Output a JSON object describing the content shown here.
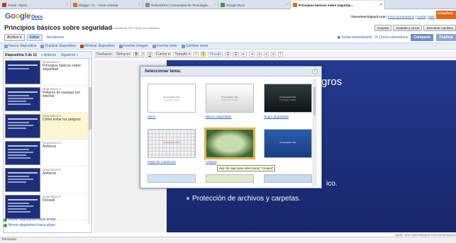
{
  "browser": {
    "tabs": [
      {
        "label": "Gmail - Spam",
        "fav_color": "#c0392b"
      },
      {
        "label": "Blogger: CL - Crear entrada",
        "fav_color": "#e26a1b"
      },
      {
        "label": "RedUSERS | Comunidad de Tecnología ...",
        "fav_color": "#8a8a8a"
      },
      {
        "label": "Google Docs",
        "fav_color": "#3a9a3a"
      },
      {
        "label": "Principios básicos sobre segurida...",
        "fav_color": "#e26a1b",
        "active": true
      }
    ]
  },
  "header": {
    "logo_letters": [
      "G",
      "o",
      "o",
      "g",
      "l",
      "e"
    ],
    "logo_docs": "Docs",
    "user_email": "franceloer@gmail.com",
    "link_inicio": "Inicio Documentos",
    "link_ayuda": "Ayuda",
    "link_salir": "Salir",
    "actualizar": "Actualizar"
  },
  "doc": {
    "title": "Principios básicos sobre seguridad",
    "saved_note": "Guardado el 4 de octubre de 2007 16:04 por Franceloer"
  },
  "top_buttons": {
    "guardar": "Guardar",
    "guardar_cerrar": "Guardar y cerrar",
    "descartar": "Descartar cambios"
  },
  "menu": {
    "archivo": "Archivo ▾",
    "editar": "Editar",
    "revisiones": "Revisiones",
    "iniciar": "Iniciar presentación",
    "correo": "Correo electrónico",
    "compartir": "Compartir",
    "publicar": "Publicar"
  },
  "actions": [
    "Nueva diapositiva",
    "Duplicar diapositiva",
    "Eliminar diapositiva",
    "Insertar imagen",
    "Insertar texto",
    "Cambiar tema"
  ],
  "slides_panel": {
    "counter": "Diapositiva 3 de 12",
    "prev": "« Anterior",
    "next": "Siguiente »",
    "move_up": "Mover diapositiva hacia arriba",
    "move_down": "Mover diapositiva hacia abajo",
    "items": [
      {
        "num": "Diapositiva 1",
        "title": "Principios básicos sobre seguridad"
      },
      {
        "num": "Diapositiva 2",
        "title": "Peligros de navegar por internet"
      },
      {
        "num": "Diapositiva 3",
        "title": "Cómo evitar los peligros",
        "selected": true
      },
      {
        "num": "Diapositiva 4",
        "title": "Antivirus"
      },
      {
        "num": "Diapositiva 5",
        "title": "Antivirus"
      },
      {
        "num": "Diapositiva 6",
        "title": "Firewall"
      }
    ]
  },
  "format_bar": [
    "Deshacer",
    "Rehacer",
    "B",
    "I",
    "U",
    "Fuente ▾",
    "Tamaño ▾",
    "T",
    "T",
    "Vínculo",
    "☰",
    "☰",
    "⇤",
    "⇥",
    "≡",
    "≡",
    "≡",
    "T"
  ],
  "slide": {
    "partial_text": "gros",
    "bullet_partial": "ico.",
    "bullet": "Protección de archivos y carpetas."
  },
  "modal": {
    "title": "Seleccionar tema:",
    "close": "x",
    "themes": [
      {
        "label": "Vacío",
        "preview_title": "Presentation Title",
        "preview_sub": "Presentation Subtitle"
      },
      {
        "label": "Blanco degradado",
        "preview_title": "Presentation Title",
        "preview_sub": "Presentation Subtitle"
      },
      {
        "label": "Negro degradado",
        "preview_title": "Presentation Title",
        "preview_sub": "Presentation Subtitle"
      },
      {
        "label": "Papel de cuadrícula",
        "preview_title": "Presentation Title",
        "preview_sub": ""
      },
      {
        "label": "Césped",
        "preview_title": "",
        "preview_sub": ""
      },
      {
        "label": "",
        "preview_title": "Presentation Title",
        "preview_sub": ""
      }
    ],
    "tooltip": "Haz clic aquí para seleccionar \"Césped\""
  },
  "status": {
    "right": "Nadie más está editando esta presentación",
    "bottom": "Terminado"
  }
}
